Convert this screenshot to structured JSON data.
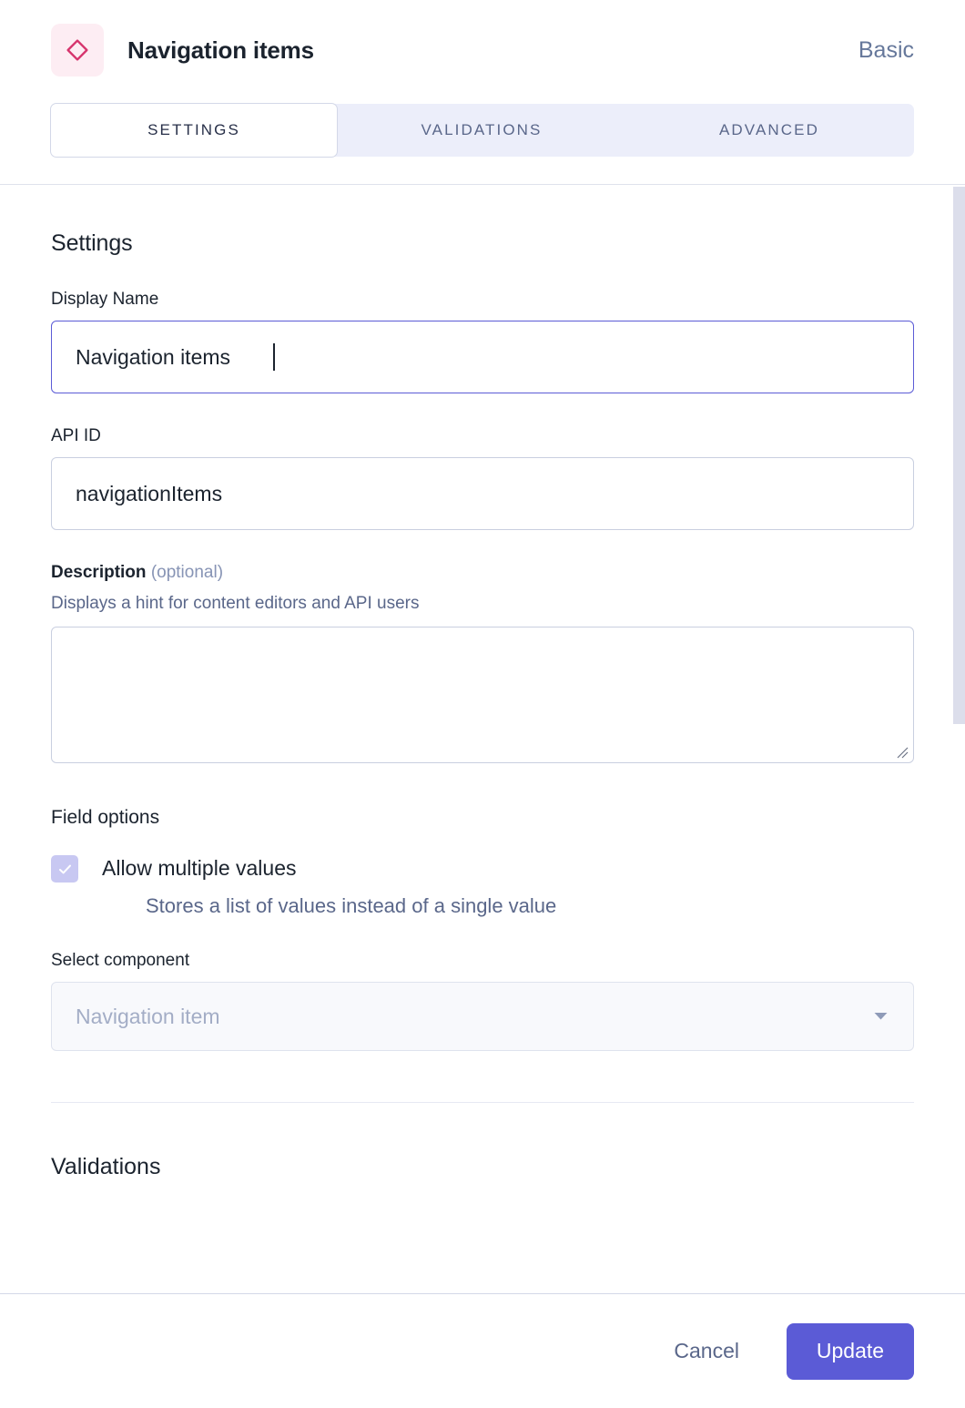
{
  "header": {
    "icon_name": "diamond-field-icon",
    "title": "Navigation items",
    "badge": "Basic"
  },
  "tabs": [
    {
      "id": "settings",
      "label": "SETTINGS",
      "active": true
    },
    {
      "id": "validations",
      "label": "VALIDATIONS",
      "active": false
    },
    {
      "id": "advanced",
      "label": "ADVANCED",
      "active": false
    }
  ],
  "settings": {
    "section_title": "Settings",
    "display_name": {
      "label": "Display Name",
      "value": "Navigation items",
      "placeholder": ""
    },
    "api_id": {
      "label": "API ID",
      "value": "navigationItems",
      "placeholder": ""
    },
    "description": {
      "label": "Description",
      "optional_suffix": "(optional)",
      "help": "Displays a hint for content editors and API users",
      "value": "",
      "placeholder": ""
    },
    "field_options": {
      "title": "Field options",
      "allow_multiple": {
        "label": "Allow multiple values",
        "help": "Stores a list of values instead of a single value",
        "checked": true
      }
    },
    "select_component": {
      "label": "Select component",
      "value": "Navigation item",
      "placeholder": "Navigation item"
    }
  },
  "validations": {
    "section_title": "Validations"
  },
  "footer": {
    "cancel_label": "Cancel",
    "update_label": "Update"
  },
  "colors": {
    "accent": "#5b5bd6",
    "icon_pink": "#d6336c",
    "icon_pink_bg": "#fdedf3",
    "tab_bar_bg": "#eceefa",
    "muted_text": "#5a678a",
    "checkbox_fill": "#c8c8f2",
    "scrollbar": "#dcdeeb"
  }
}
